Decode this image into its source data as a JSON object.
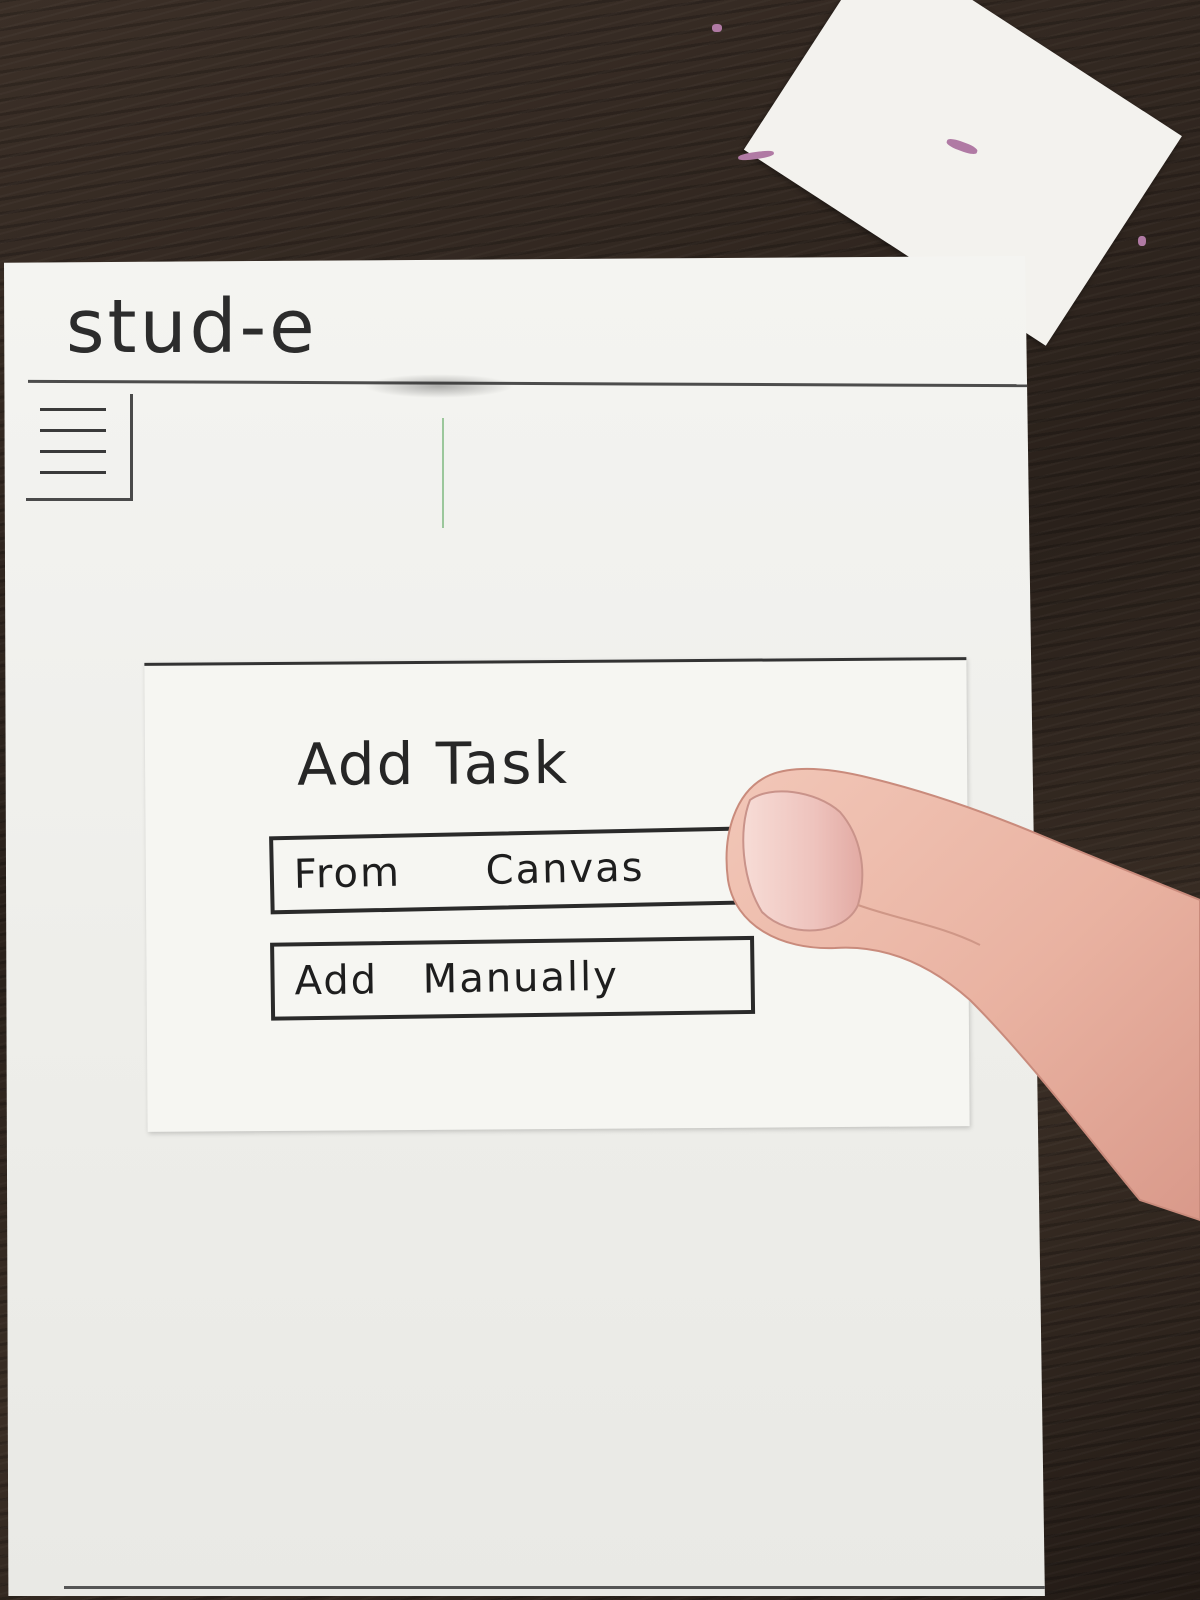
{
  "app": {
    "title": "stud-e"
  },
  "header": {
    "menu_icon": "hamburger-menu-icon"
  },
  "dialog": {
    "title": "Add Task",
    "buttons": [
      {
        "label": "From Canvas"
      },
      {
        "label": "Add Manually"
      }
    ]
  },
  "colors": {
    "paper": "#f4f4f1",
    "ink": "#2a2a2a",
    "table": "#2e241e"
  }
}
